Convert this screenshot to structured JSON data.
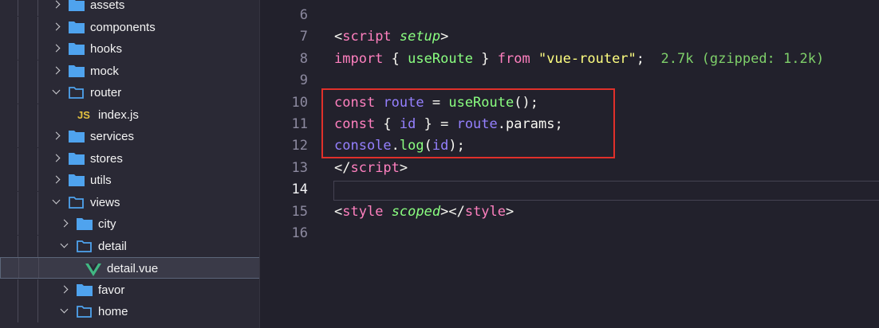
{
  "explorer": {
    "items": [
      {
        "label": "assets",
        "type": "folder",
        "level": 1,
        "expanded": false
      },
      {
        "label": "components",
        "type": "folder",
        "level": 1,
        "expanded": false
      },
      {
        "label": "hooks",
        "type": "folder",
        "level": 1,
        "expanded": false
      },
      {
        "label": "mock",
        "type": "folder",
        "level": 1,
        "expanded": false
      },
      {
        "label": "router",
        "type": "folder",
        "level": 1,
        "expanded": true
      },
      {
        "label": "index.js",
        "type": "js-file",
        "level": 2,
        "icon_text": "JS"
      },
      {
        "label": "services",
        "type": "folder",
        "level": 1,
        "expanded": false
      },
      {
        "label": "stores",
        "type": "folder",
        "level": 1,
        "expanded": false
      },
      {
        "label": "utils",
        "type": "folder",
        "level": 1,
        "expanded": false
      },
      {
        "label": "views",
        "type": "folder",
        "level": 1,
        "expanded": true
      },
      {
        "label": "city",
        "type": "folder",
        "level": 2,
        "expanded": false
      },
      {
        "label": "detail",
        "type": "folder",
        "level": 2,
        "expanded": true
      },
      {
        "label": "detail.vue",
        "type": "vue-file",
        "level": 3,
        "selected": true
      },
      {
        "label": "favor",
        "type": "folder",
        "level": 2,
        "expanded": false
      },
      {
        "label": "home",
        "type": "folder",
        "level": 2,
        "expanded": true
      }
    ]
  },
  "editor": {
    "active_line": "14",
    "lines": [
      {
        "num": "6",
        "tokens": []
      },
      {
        "num": "7",
        "tokens": [
          [
            "punc",
            "<"
          ],
          [
            "kw",
            "script"
          ],
          [
            "punc",
            " "
          ],
          [
            "attr",
            "setup"
          ],
          [
            "punc",
            ">"
          ]
        ]
      },
      {
        "num": "8",
        "tokens": [
          [
            "kw",
            "import"
          ],
          [
            "punc",
            " { "
          ],
          [
            "fn",
            "useRoute"
          ],
          [
            "punc",
            " } "
          ],
          [
            "kw",
            "from"
          ],
          [
            "punc",
            " "
          ],
          [
            "str",
            "\"vue-router\""
          ],
          [
            "punc",
            ";  "
          ],
          [
            "hint",
            "2.7k (gzipped: 1.2k)"
          ]
        ]
      },
      {
        "num": "9",
        "tokens": []
      },
      {
        "num": "10",
        "tokens": [
          [
            "kw",
            "const"
          ],
          [
            "punc",
            " "
          ],
          [
            "var",
            "route"
          ],
          [
            "punc",
            " = "
          ],
          [
            "fn",
            "useRoute"
          ],
          [
            "punc",
            "();"
          ]
        ]
      },
      {
        "num": "11",
        "tokens": [
          [
            "kw",
            "const"
          ],
          [
            "punc",
            " { "
          ],
          [
            "var",
            "id"
          ],
          [
            "punc",
            " } = "
          ],
          [
            "var",
            "route"
          ],
          [
            "punc",
            "."
          ],
          [
            "punc",
            "params"
          ],
          [
            "punc",
            ";"
          ]
        ]
      },
      {
        "num": "12",
        "tokens": [
          [
            "var",
            "console"
          ],
          [
            "punc",
            "."
          ],
          [
            "fn",
            "log"
          ],
          [
            "punc",
            "("
          ],
          [
            "var",
            "id"
          ],
          [
            "punc",
            ");"
          ]
        ]
      },
      {
        "num": "13",
        "tokens": [
          [
            "punc",
            "</"
          ],
          [
            "kw",
            "script"
          ],
          [
            "punc",
            ">"
          ]
        ]
      },
      {
        "num": "14",
        "tokens": []
      },
      {
        "num": "15",
        "tokens": [
          [
            "punc",
            "<"
          ],
          [
            "kw",
            "style"
          ],
          [
            "punc",
            " "
          ],
          [
            "attr",
            "scoped"
          ],
          [
            "punc",
            "></"
          ],
          [
            "kw",
            "style"
          ],
          [
            "punc",
            ">"
          ]
        ]
      },
      {
        "num": "16",
        "tokens": []
      }
    ]
  },
  "colors": {
    "folder": "#4fa3ee",
    "vue_icon": "#41b883",
    "highlight_box": "#e0302a"
  }
}
